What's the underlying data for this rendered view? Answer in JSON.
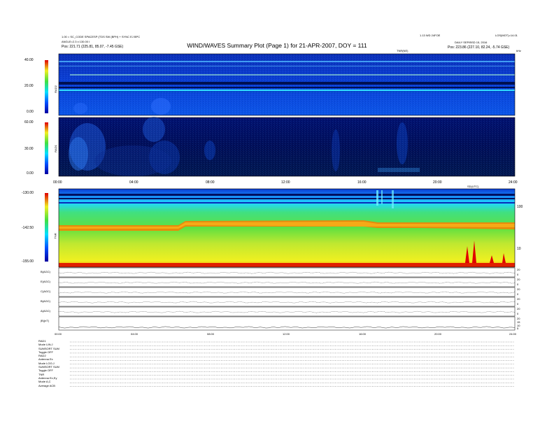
{
  "header": {
    "title": "WIND/WAVES Summary Plot (Page 1) for 21-APR-2007, DOY = 111",
    "left_line1": "1.00 = SC_CODE  SPACESP  (TDS SW  (BPH) + SYNC EJ BPC",
    "left_line2": "ANGLE=2.3 x 130.00 I",
    "left_line3": "Pos:  221.71 (225.81, 85.07, -7.45 GSE)",
    "right_line1": "1.13 WD 24FOE",
    "right_line2": "DAILY  SEP/BSD  15, 2016",
    "right_line3": "Pos:  223.86 (227.10, 82.24, -5.74 GSE)",
    "right_corner": "LOS(MOT)=14.01",
    "label_khz_top": "TNR(NE)",
    "label_unit": "kHz",
    "label_sdate": "SD(UTC)"
  },
  "panels": {
    "rad2": {
      "label": "RAD2",
      "ticks": [
        "40.00",
        "20.00",
        "0.00"
      ]
    },
    "rad1": {
      "label": "RAD1",
      "ticks": [
        "60.00",
        "30.00",
        "0.00"
      ]
    },
    "tnr": {
      "label": "TNR",
      "ticks": [
        "-130.00",
        "-142.50",
        "-155.00"
      ],
      "right_ticks": [
        "100",
        "10"
      ]
    }
  },
  "time_axis": {
    "labels": [
      "00:00",
      "04:00",
      "08:00",
      "12:00",
      "16:00",
      "20:00",
      "24:00"
    ]
  },
  "lower_axis": {
    "labels": [
      "00:00",
      "04:00",
      "08:00",
      "12:00",
      "16:00",
      "20:00",
      "24:00"
    ]
  },
  "strip_panels": [
    {
      "label": "B(AGC)",
      "right": [
        "20",
        "0"
      ]
    },
    {
      "label": "E(AGC)",
      "right": [
        "20",
        "0"
      ]
    },
    {
      "label": "C(AGC)",
      "right": [
        "20",
        "0"
      ]
    },
    {
      "label": "B(AGC)",
      "right": [
        "20",
        "0"
      ]
    },
    {
      "label": "A(AGC)",
      "right": [
        "20",
        "0"
      ]
    },
    {
      "label": "|B|(nT)",
      "right": [
        "20",
        "15",
        "10",
        "5"
      ]
    }
  ],
  "settings": [
    "RAD1",
    "Mode    LIN:J",
    "SUMSORT  SUM",
    "Toggle   OFF",
    "RAD2",
    "Antenna    Ex",
    "Mode    LOG:J",
    "SUMSORT  SUM",
    "Toggle   OFF",
    "TNR",
    "Antenna   Ex,Ey",
    "Mode    A,C",
    "Average   ACB"
  ],
  "colors": {
    "bg_dark": "#00115f",
    "blue": "#0a40d8",
    "cyan": "#20d0ff",
    "green": "#40e060",
    "yellow": "#e8e830",
    "orange": "#ff8000",
    "red": "#e00000"
  },
  "chart_data": {
    "type": "heatmap",
    "title": "WIND/WAVES Summary Plot (Page 1) for 21-APR-2007, DOY = 111",
    "xlabel": "",
    "x_range_hours": [
      0,
      24
    ],
    "panels": [
      {
        "name": "RAD2",
        "ylim": [
          0,
          40
        ],
        "color_scale": "relative intensity"
      },
      {
        "name": "RAD1",
        "ylim": [
          0,
          60
        ],
        "color_scale": "relative intensity"
      },
      {
        "name": "TNR",
        "ylim": [
          -155,
          -130
        ],
        "y_right_ticks": [
          100,
          10
        ],
        "y_right_scale": "log"
      }
    ]
  }
}
